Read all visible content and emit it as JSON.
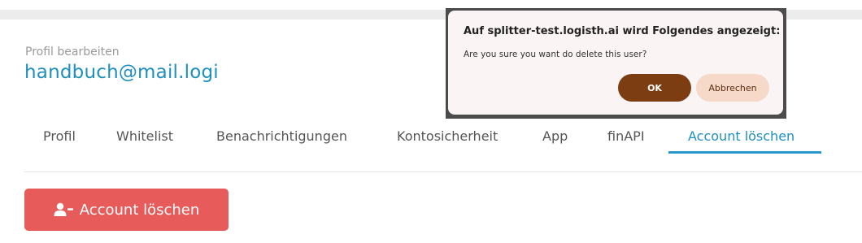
{
  "profile": {
    "subtitle": "Profil bearbeiten",
    "email": "handbuch@mail.logi"
  },
  "tabs": [
    {
      "label": "Profil",
      "active": false
    },
    {
      "label": "Whitelist",
      "active": false
    },
    {
      "label": "Benachrichtigungen",
      "active": false
    },
    {
      "label": "Kontosicherheit",
      "active": false
    },
    {
      "label": "App",
      "active": false
    },
    {
      "label": "finAPI",
      "active": false
    },
    {
      "label": "Account löschen",
      "active": true
    }
  ],
  "action": {
    "delete_label": "Account löschen",
    "icon": "user-minus-icon",
    "color": "#e85b5b"
  },
  "dialog": {
    "title": "Auf splitter-test.logisth.ai wird Folgendes angezeigt:",
    "message": "Are you sure you want do delete this user?",
    "ok_label": "OK",
    "cancel_label": "Abbrechen"
  },
  "colors": {
    "accent": "#1e8fbf",
    "ok_button": "#7b3d11",
    "cancel_button": "#f6d9c8"
  }
}
